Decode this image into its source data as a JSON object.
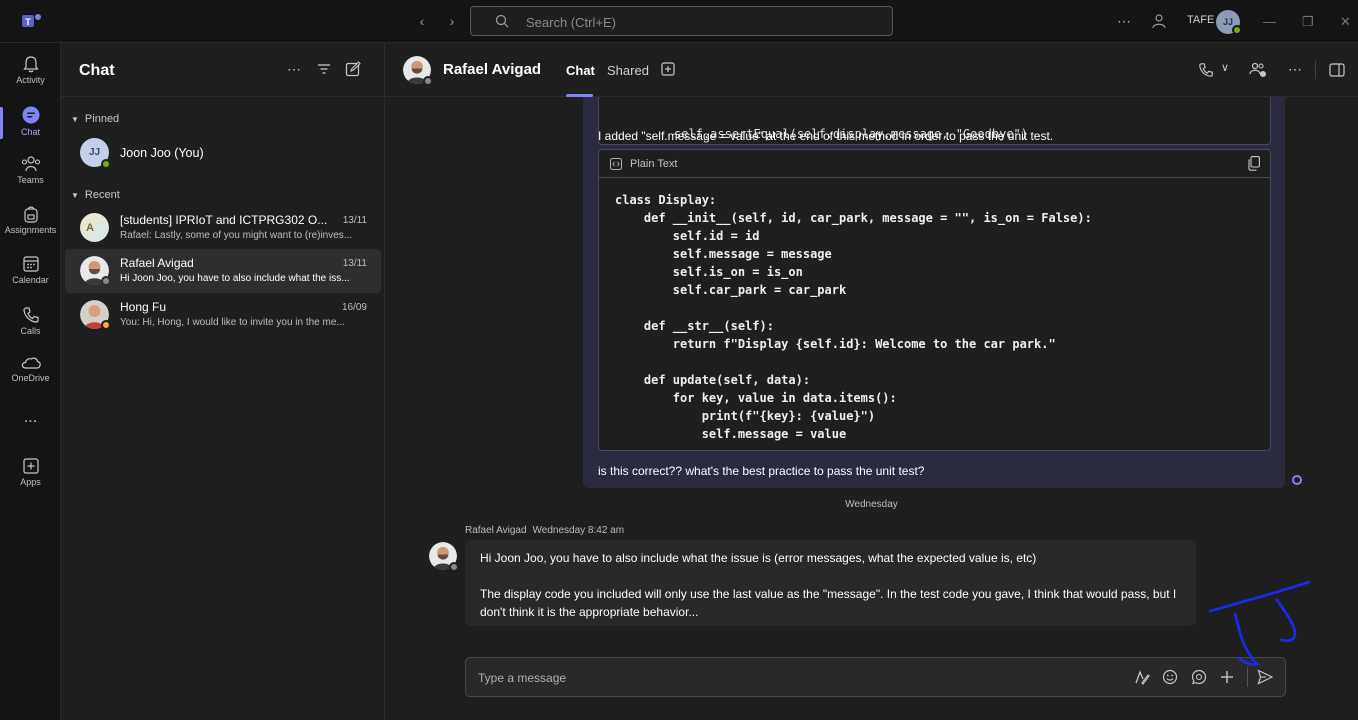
{
  "titlebar": {
    "search_placeholder": "Search (Ctrl+E)",
    "org_label": "TAFE",
    "user_initials": "JJ"
  },
  "rail": {
    "items": [
      {
        "label": "Activity",
        "icon": "bell-icon"
      },
      {
        "label": "Chat",
        "icon": "chat-icon"
      },
      {
        "label": "Teams",
        "icon": "teams-icon"
      },
      {
        "label": "Assignments",
        "icon": "backpack-icon"
      },
      {
        "label": "Calendar",
        "icon": "calendar-icon"
      },
      {
        "label": "Calls",
        "icon": "phone-icon"
      },
      {
        "label": "OneDrive",
        "icon": "cloud-icon"
      },
      {
        "label": "...",
        "icon": "more-icon"
      },
      {
        "label": "Apps",
        "icon": "apps-icon"
      }
    ]
  },
  "chatlist": {
    "title": "Chat",
    "pinned_label": "Pinned",
    "recent_label": "Recent",
    "pinned": [
      {
        "name": "Joon Joo (You)",
        "initials": "JJ"
      }
    ],
    "recent": [
      {
        "name": "[students] IPRIoT and ICTPRG302 O...",
        "preview": "Rafael: Lastly, some of you might want to (re)inves...",
        "date": "13/11"
      },
      {
        "name": "Rafael Avigad",
        "preview": "Hi Joon Joo, you have to also include what the iss...",
        "date": "13/11"
      },
      {
        "name": "Hong Fu",
        "preview": "You: Hi, Hong, I would like to invite you in the me...",
        "date": "16/09"
      }
    ]
  },
  "main": {
    "contact_name": "Rafael Avigad",
    "tabs": [
      "Chat",
      "Shared"
    ],
    "prev_code_cut": "self.assertEqual(self.display.message, \"Goodbye\")",
    "my_text1": "I added \"self.message = value\" at the end of this method in order to pass the unit test.",
    "code_lang": "Plain Text",
    "code": "class Display:\n    def __init__(self, id, car_park, message = \"\", is_on = False):\n        self.id = id\n        self.message = message\n        self.is_on = is_on\n        self.car_park = car_park\n\n    def __str__(self):\n        return f\"Display {self.id}: Welcome to the car park.\"\n\n    def update(self, data):\n        for key, value in data.items():\n            print(f\"{key}: {value}\")\n            self.message = value",
    "my_text2": "is this correct?? what's the best practice to pass the unit test?",
    "day_divider": "Wednesday",
    "reply_sender": "Rafael Avigad",
    "reply_time": "Wednesday 8:42 am",
    "reply_p1": "Hi Joon Joo, you have to also include what the issue is (error messages, what the expected value is, etc)",
    "reply_p2": "The display code you included will only use the last value as the \"message\". In the test code you gave, I think that would pass, but I don't think it is the appropriate behavior...",
    "composer_placeholder": "Type a message"
  },
  "colors": {
    "accent": "#7f85f5",
    "my_bubble": "#2b2b40",
    "their_bubble": "#292929",
    "ink": "#1a2cf0"
  }
}
